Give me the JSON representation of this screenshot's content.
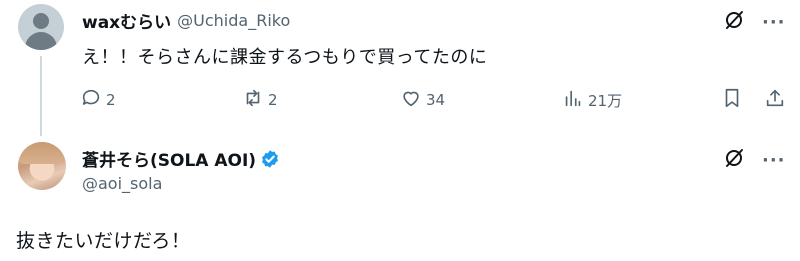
{
  "reply": {
    "display_name": "waxむらい",
    "handle": "@Uchida_Riko",
    "text": "え！！そらさんに課金するつもりで買ってたのに",
    "actions": {
      "replies": "2",
      "reposts": "2",
      "likes": "34",
      "views": "21万"
    }
  },
  "main": {
    "display_name": "蒼井そら(SOLA AOI)",
    "handle": "@aoi_sola",
    "text": "抜きたいだけだろ！",
    "verified": true
  },
  "icons": {
    "reply": "speech-bubble-icon",
    "repost": "repost-arrows-icon",
    "like": "heart-icon",
    "views": "bar-chart-icon",
    "bookmark": "bookmark-icon",
    "share": "share-upload-icon",
    "grok": "grok-slash-circle-icon",
    "more": "more-dots-icon",
    "verified": "verified-badge-icon"
  },
  "colors": {
    "text_primary": "#0f1419",
    "text_secondary": "#536471",
    "verified_blue": "#1d9bf0",
    "thread_line": "#cfd9de"
  },
  "more_label": "···"
}
